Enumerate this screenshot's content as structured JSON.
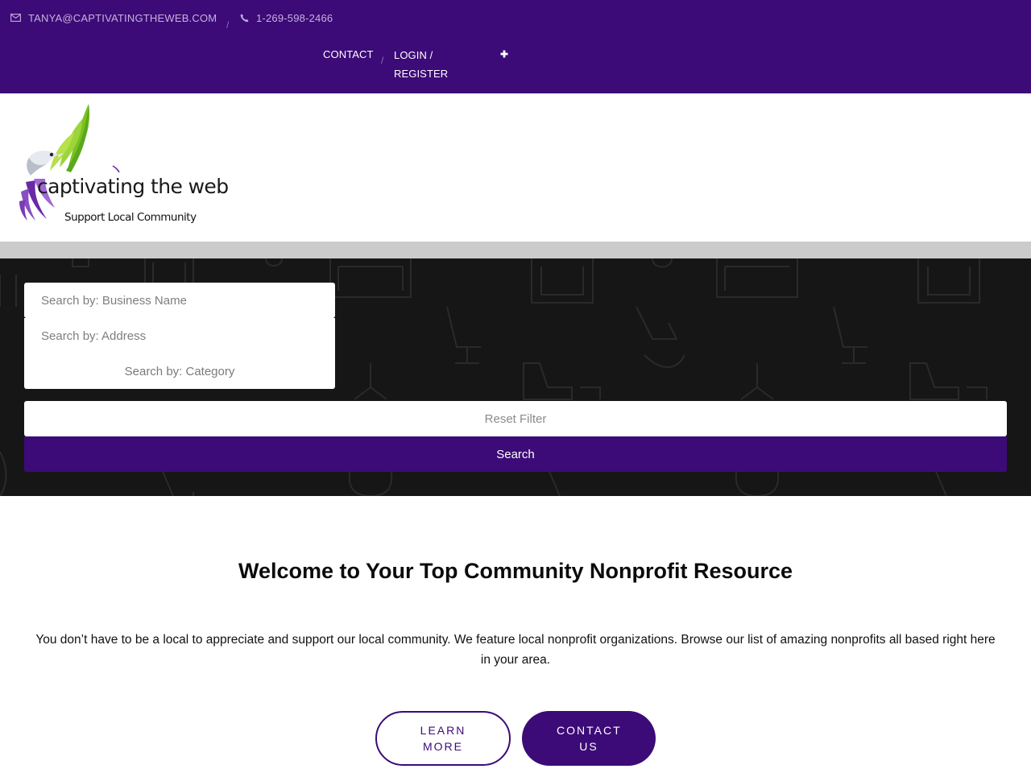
{
  "topbar": {
    "email": "TANYA@CAPTIVATINGTHEWEB.COM",
    "phone": "1-269-598-2466",
    "separator": "/",
    "nav": {
      "contact": "CONTACT",
      "login": "LOGIN / REGISTER"
    },
    "icons": [
      "envelope-icon",
      "phone-icon",
      "plus-icon"
    ]
  },
  "logo": {
    "name": "captivating the web",
    "tagline": "Support Local Community"
  },
  "search": {
    "name_placeholder": "Search by: Business Name",
    "address_placeholder": "Search by: Address",
    "category_placeholder": "Search by: Category",
    "reset_label": "Reset Filter",
    "search_label": "Search"
  },
  "welcome": {
    "title": "Welcome to Your Top Community Nonprofit Resource",
    "text": "You don’t have to be a local to appreciate and support our local community. We feature local nonprofit organizations. Browse our list of amazing nonprofits all based right here in your area.",
    "learn_more": "LEARN MORE",
    "contact_us": "CONTACT US"
  },
  "colors": {
    "brand_purple": "#3c0b77",
    "dark_section": "#161616",
    "grey_strip": "#cbcbcb"
  }
}
